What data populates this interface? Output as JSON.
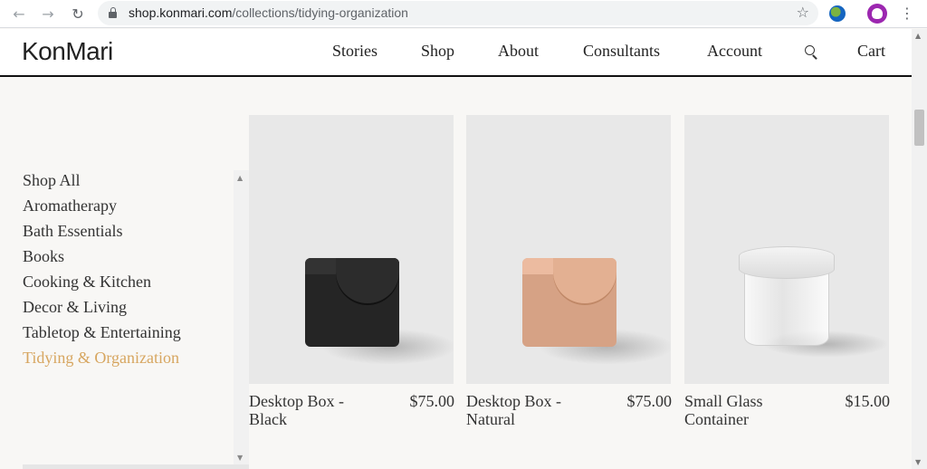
{
  "browser": {
    "url_domain": "shop.konmari.com",
    "url_path": "/collections/tidying-organization",
    "icons": [
      "back-arrow-icon",
      "forward-arrow-icon",
      "reload-icon",
      "lock-icon",
      "star-icon",
      "extension-icon",
      "profile-avatar-icon",
      "menu-dots-icon"
    ]
  },
  "header": {
    "logo": "KonMari",
    "nav": [
      {
        "label": "Stories"
      },
      {
        "label": "Shop"
      },
      {
        "label": "About"
      },
      {
        "label": "Consultants"
      },
      {
        "label": "Account"
      }
    ],
    "cart_label": "Cart"
  },
  "sidebar": {
    "categories": [
      {
        "label": "Shop All",
        "active": false
      },
      {
        "label": "Aromatherapy",
        "active": false
      },
      {
        "label": "Bath Essentials",
        "active": false
      },
      {
        "label": "Books",
        "active": false
      },
      {
        "label": "Cooking & Kitchen",
        "active": false
      },
      {
        "label": "Decor & Living",
        "active": false
      },
      {
        "label": "Tabletop & Entertaining",
        "active": false
      },
      {
        "label": "Tidying & Organization",
        "active": true
      }
    ],
    "active_color": "#d7a660"
  },
  "products": [
    {
      "name": "Desktop Box - Black",
      "price": "$75.00",
      "image": "black-box-image"
    },
    {
      "name": "Desktop Box - Natural",
      "price": "$75.00",
      "image": "natural-box-image"
    },
    {
      "name": "Small Glass Container",
      "price": "$15.00",
      "image": "glass-container-image"
    }
  ],
  "colors": {
    "page_background": "#f8f7f5",
    "product_image_background": "#e8e8e8",
    "text": "#222222"
  }
}
